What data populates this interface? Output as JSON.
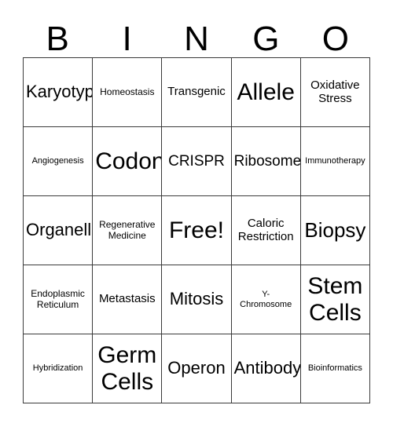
{
  "card": {
    "header_letters": [
      "B",
      "I",
      "N",
      "G",
      "O"
    ],
    "free_space_label": "Free!",
    "grid": [
      [
        {
          "text": "Karyotype",
          "size": "md"
        },
        {
          "text": "Homeostasis",
          "size": "xxs"
        },
        {
          "text": "Transgenic",
          "size": "xs"
        },
        {
          "text": "Allele",
          "size": "xl"
        },
        {
          "text": "Oxidative\nStress",
          "size": "xs"
        }
      ],
      [
        {
          "text": "Angiogenesis",
          "size": "tiny"
        },
        {
          "text": "Codon",
          "size": "xl"
        },
        {
          "text": "CRISPR",
          "size": "sm"
        },
        {
          "text": "Ribosome",
          "size": "sm"
        },
        {
          "text": "Immunotherapy",
          "size": "tiny"
        }
      ],
      [
        {
          "text": "Organelle",
          "size": "md"
        },
        {
          "text": "Regenerative\nMedicine",
          "size": "xxs"
        },
        {
          "text": "Free!",
          "size": "xl"
        },
        {
          "text": "Caloric\nRestriction",
          "size": "xs"
        },
        {
          "text": "Biopsy",
          "size": "lg"
        }
      ],
      [
        {
          "text": "Endoplasmic\nReticulum",
          "size": "xxs"
        },
        {
          "text": "Metastasis",
          "size": "xs"
        },
        {
          "text": "Mitosis",
          "size": "md"
        },
        {
          "text": "Y-\nChromosome",
          "size": "tiny"
        },
        {
          "text": "Stem\nCells",
          "size": "xl"
        }
      ],
      [
        {
          "text": "Hybridization",
          "size": "tiny"
        },
        {
          "text": "Germ\nCells",
          "size": "xl"
        },
        {
          "text": "Operon",
          "size": "md"
        },
        {
          "text": "Antibody",
          "size": "md"
        },
        {
          "text": "Bioinformatics",
          "size": "tiny"
        }
      ]
    ]
  }
}
